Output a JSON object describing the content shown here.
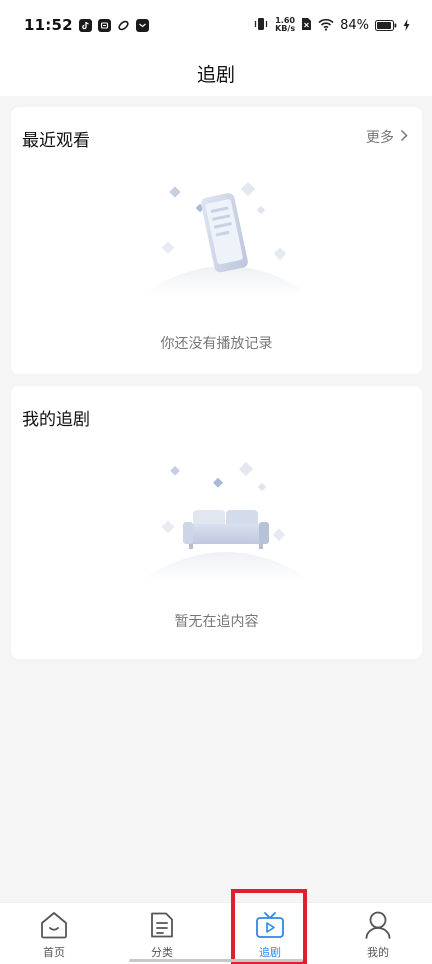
{
  "status_bar": {
    "time": "11:52",
    "net_speed_value": "1.60",
    "net_speed_unit": "KB/s",
    "battery": "84%"
  },
  "header": {
    "title": "追剧"
  },
  "recent": {
    "title": "最近观看",
    "more_label": "更多",
    "empty_text": "你还没有播放记录"
  },
  "following": {
    "title": "我的追剧",
    "empty_text": "暂无在追内容"
  },
  "bottom_nav": {
    "items": [
      {
        "label": "首页",
        "icon": "home-icon"
      },
      {
        "label": "分类",
        "icon": "category-icon"
      },
      {
        "label": "追剧",
        "icon": "tv-icon",
        "active": true
      },
      {
        "label": "我的",
        "icon": "profile-icon"
      }
    ]
  },
  "colors": {
    "accent": "#2f86e8",
    "highlight": "#e0202a",
    "background": "#f5f5f5"
  }
}
